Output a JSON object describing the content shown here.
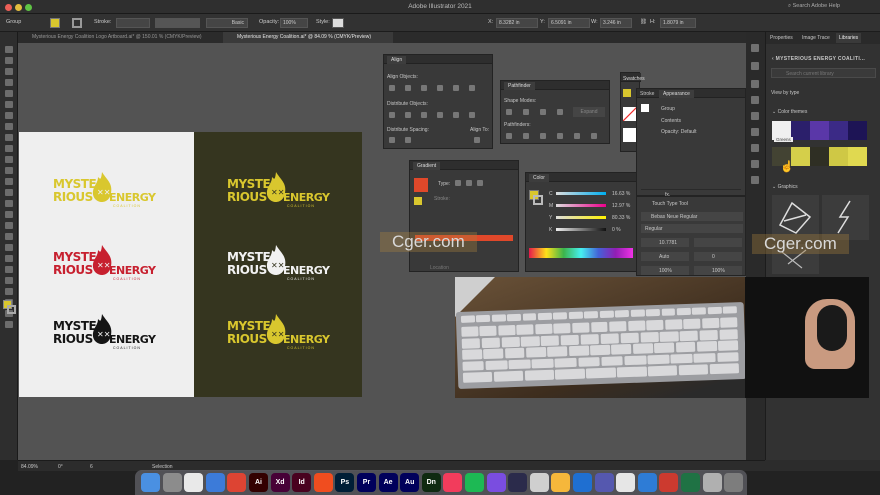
{
  "app": {
    "title": "Adobe Illustrator 2021",
    "search": "Search Adobe Help"
  },
  "control_bar": {
    "selection": "Group",
    "stroke_label": "Stroke:",
    "brush": "Basic",
    "opacity_label": "Opacity:",
    "opacity_value": "100%",
    "style_label": "Style:",
    "x_label": "X:",
    "x_value": "8.3282 in",
    "y_label": "Y:",
    "y_value": "6.5091 in",
    "w_label": "W:",
    "w_value": "3.246 in",
    "h_label": "H:",
    "h_value": "1.8079 in"
  },
  "tabs": [
    {
      "label": "Mysterious Energy Coalition Logo Artboard.ai* @ 150.01 % (CMYK/Preview)"
    },
    {
      "label": "Mysterious Energy Coalition.ai* @ 84.09 % (CMYK/Preview)"
    }
  ],
  "logo": {
    "line1": "MYSTE",
    "line2": "RIOUS",
    "line3": "ENERGY",
    "sub": "COALITION"
  },
  "colors": {
    "yellow": "#d9c72e",
    "red": "#c7202f",
    "black": "#151515",
    "white": "#f2f2f2",
    "accent": "#e0482a"
  },
  "align_panel": {
    "title": "Align",
    "align_objects": "Align Objects:",
    "distribute_objects": "Distribute Objects:",
    "distribute_spacing": "Distribute Spacing:",
    "align_to": "Align To:"
  },
  "pathfinder_panel": {
    "title": "Pathfinder",
    "shape_modes": "Shape Modes:",
    "expand": "Expand",
    "pathfinders": "Pathfinders:"
  },
  "gradient_panel": {
    "title": "Gradient",
    "type": "Type:",
    "stroke": "Stroke:",
    "location": "Location"
  },
  "color_panel": {
    "title": "Color",
    "c_label": "C",
    "c_value": "16.63",
    "m_label": "M",
    "m_value": "12.97",
    "y_label": "Y",
    "y_value": "80.33",
    "k_label": "K",
    "k_value": "0",
    "unit": "%"
  },
  "swatches_panel": {
    "title": "Swatches"
  },
  "appearance_panel": {
    "title": "Appearance",
    "stroke": "Stroke",
    "group": "Group",
    "contents": "Contents",
    "opacity": "Opacity: Default",
    "fx": "fx."
  },
  "character_panel": {
    "tool": "Touch Type Tool",
    "font": "Bebas Neue Regular",
    "style": "Regular",
    "size": "10.7781",
    "leading": "Auto",
    "kerning": "0",
    "scale_h": "100%",
    "scale_v": "100%"
  },
  "right_panel": {
    "tabs": [
      "Properties",
      "Image Trace",
      "Libraries"
    ],
    "library_name": "MYSTERIOUS ENERGY COALITI...",
    "search_placeholder": "Search current library",
    "view_by": "View by type",
    "color_themes": "Color themes",
    "tooltip": "Greens",
    "graphics": "Graphics"
  },
  "theme_row1": [
    "#f0f0f0",
    "#2b1f6b",
    "#5a37a8",
    "#3b2a86",
    "#1d1455"
  ],
  "theme_row2": [
    "#434333",
    "#d5cf4a",
    "#2f2f24",
    "#cfc845",
    "#e0d950"
  ],
  "watermark": "Cger.com",
  "status_bar": {
    "zoom": "84.09%",
    "rotation": "0°",
    "artboard": "6",
    "mode": "Selection"
  },
  "dock_apps": [
    {
      "label": "",
      "color": "#4a90e2"
    },
    {
      "label": "",
      "color": "#8c8c8c"
    },
    {
      "label": "",
      "color": "#e9e9e9"
    },
    {
      "label": "",
      "color": "#3c7bd9"
    },
    {
      "label": "",
      "color": "#dd4433"
    },
    {
      "label": "Ai",
      "color": "#330000"
    },
    {
      "label": "Xd",
      "color": "#470137"
    },
    {
      "label": "Id",
      "color": "#49021f"
    },
    {
      "label": "",
      "color": "#f04d1f"
    },
    {
      "label": "Ps",
      "color": "#001e36"
    },
    {
      "label": "Pr",
      "color": "#00005b"
    },
    {
      "label": "Ae",
      "color": "#00005b"
    },
    {
      "label": "Au",
      "color": "#00005b"
    },
    {
      "label": "Dn",
      "color": "#0f2a11"
    },
    {
      "label": "",
      "color": "#f23c5c"
    },
    {
      "label": "",
      "color": "#1db954"
    },
    {
      "label": "",
      "color": "#7a4de0"
    },
    {
      "label": "",
      "color": "#2b2b4b"
    },
    {
      "label": "",
      "color": "#cfcfcf"
    },
    {
      "label": "",
      "color": "#f5b73b"
    },
    {
      "label": "",
      "color": "#1f6fd1"
    },
    {
      "label": "",
      "color": "#5558af"
    },
    {
      "label": "",
      "color": "#e6e6e6"
    },
    {
      "label": "",
      "color": "#2e7cd6"
    },
    {
      "label": "",
      "color": "#cc3a2f"
    },
    {
      "label": "",
      "color": "#1f7244"
    },
    {
      "label": "",
      "color": "#b0b0b0"
    },
    {
      "label": "",
      "color": "#7d7d7d"
    }
  ]
}
